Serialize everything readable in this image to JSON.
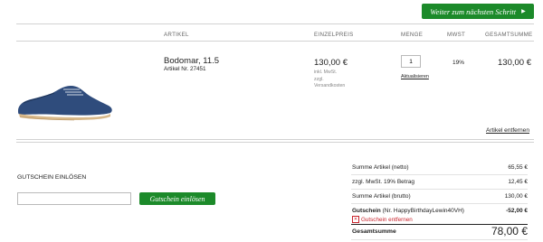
{
  "header": {
    "next_step_label": "Weiter zum nächsten Schritt"
  },
  "table": {
    "headers": {
      "article": "ARTIKEL",
      "unit_price": "EINZELPREIS",
      "quantity": "MENGE",
      "vat": "MWST",
      "total": "GESAMTSUMME"
    }
  },
  "item": {
    "name": "Bodomar, 11.5",
    "sku": "Artikel Nr. 27451",
    "unit_price": "130,00 €",
    "price_note_1": "inkl. MwSt.",
    "price_note_2": "zzgl.",
    "price_note_3": "Versandkosten",
    "quantity": "1",
    "update_label": "Aktualisieren",
    "vat": "19%",
    "total": "130,00 €",
    "remove_label": "Artikel entfernen",
    "image_icon": "blue-suede-derby-shoe"
  },
  "coupon": {
    "title": "GUTSCHEIN EINLÖSEN",
    "input_value": "",
    "button_label": "Gutschein einlösen"
  },
  "summary": {
    "rows": [
      {
        "label": "Summe Artikel (netto)",
        "value": "65,55 €"
      },
      {
        "label": "zzgl. MwSt. 19% Betrag",
        "value": "12,45 €"
      },
      {
        "label": "Summe Artikel (brutto)",
        "value": "130,00 €"
      }
    ],
    "coupon_label": "Gutschein",
    "coupon_code": "(Nr. HappyBirthdayLewin40VH)",
    "coupon_value": "-52,00 €",
    "coupon_remove_label": "Gutschein entfernen",
    "grand_total_label": "Gesamtsumme",
    "grand_total_value": "78,00 €"
  },
  "colors": {
    "accent": "#1c8a2a",
    "danger": "#c8232c"
  }
}
